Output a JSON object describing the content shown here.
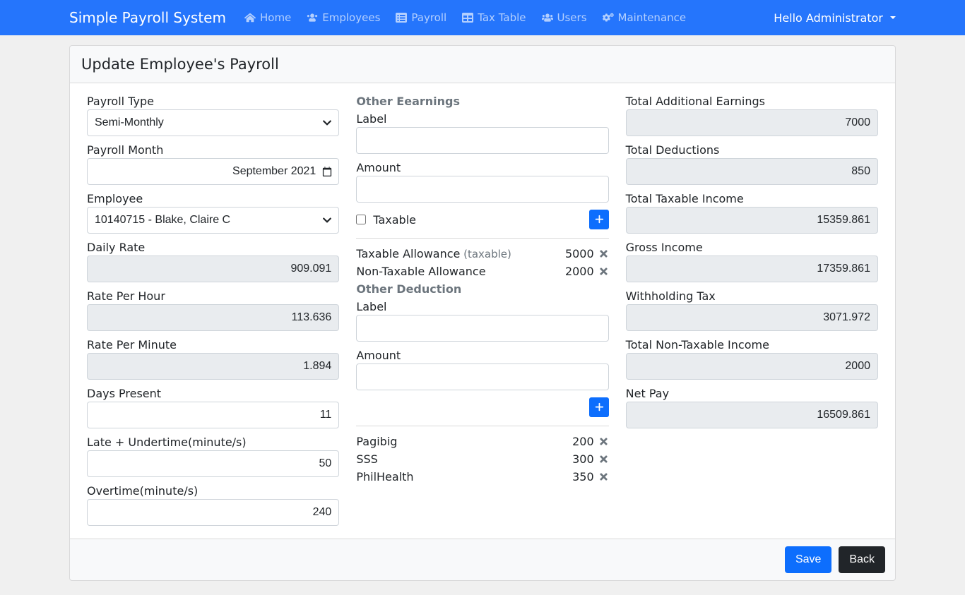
{
  "header": {
    "brand": "Simple Payroll System",
    "nav": [
      {
        "label": "Home",
        "icon": "home"
      },
      {
        "label": "Employees",
        "icon": "user"
      },
      {
        "label": "Payroll",
        "icon": "list"
      },
      {
        "label": "Tax Table",
        "icon": "table"
      },
      {
        "label": "Users",
        "icon": "users"
      },
      {
        "label": "Maintenance",
        "icon": "cogs"
      }
    ],
    "user_text": "Hello Administrator"
  },
  "card": {
    "title": "Update Employee's Payroll"
  },
  "left": {
    "payroll_type": {
      "label": "Payroll Type",
      "value": "Semi-Monthly"
    },
    "payroll_month": {
      "label": "Payroll Month",
      "value": "September 2021"
    },
    "employee": {
      "label": "Employee",
      "value": "10140715 - Blake, Claire C"
    },
    "daily_rate": {
      "label": "Daily Rate",
      "value": "909.091"
    },
    "rate_per_hour": {
      "label": "Rate Per Hour",
      "value": "113.636"
    },
    "rate_per_minute": {
      "label": "Rate Per Minute",
      "value": "1.894"
    },
    "days_present": {
      "label": "Days Present",
      "value": "11"
    },
    "late_undertime": {
      "label": "Late + Undertime(minute/s)",
      "value": "50"
    },
    "overtime": {
      "label": "Overtime(minute/s)",
      "value": "240"
    }
  },
  "middle": {
    "earnings_head": "Other Eearnings",
    "label_label": "Label",
    "amount_label": "Amount",
    "taxable_label": "Taxable",
    "earnings_items": [
      {
        "label": "Taxable Allowance",
        "suffix": "(taxable)",
        "amount": "5000"
      },
      {
        "label": "Non-Taxable Allowance",
        "suffix": "",
        "amount": "2000"
      }
    ],
    "deduction_head": "Other Deduction",
    "deduction_items": [
      {
        "label": "Pagibig",
        "amount": "200"
      },
      {
        "label": "SSS",
        "amount": "300"
      },
      {
        "label": "PhilHealth",
        "amount": "350"
      }
    ]
  },
  "right": {
    "total_additional_earnings": {
      "label": "Total Additional Earnings",
      "value": "7000"
    },
    "total_deductions": {
      "label": "Total Deductions",
      "value": "850"
    },
    "total_taxable_income": {
      "label": "Total Taxable Income",
      "value": "15359.861"
    },
    "gross_income": {
      "label": "Gross Income",
      "value": "17359.861"
    },
    "withholding_tax": {
      "label": "Withholding Tax",
      "value": "3071.972"
    },
    "total_nontaxable_income": {
      "label": "Total Non-Taxable Income",
      "value": "2000"
    },
    "net_pay": {
      "label": "Net Pay",
      "value": "16509.861"
    }
  },
  "footer": {
    "save": "Save",
    "back": "Back"
  }
}
